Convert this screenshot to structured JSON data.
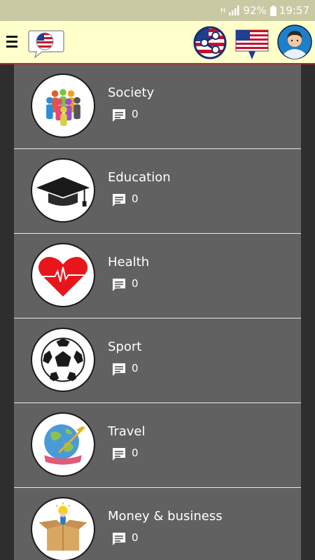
{
  "status_bar": {
    "network_label": "H",
    "battery_percent": "92%",
    "time": "19:57"
  },
  "app_bar": {
    "menu_icon": "hamburger-menu-icon",
    "language_icon": "us-flag-speech-bubble-icon",
    "share_icon": "share-icon",
    "flag_icon": "us-flag-pin-icon",
    "avatar_icon": "user-avatar-icon",
    "accent_color": "#d62020",
    "background_color": "#ffffcc"
  },
  "topics": [
    {
      "title": "Society",
      "comment_count": "0",
      "icon": "people-group-icon"
    },
    {
      "title": "Education",
      "comment_count": "0",
      "icon": "graduation-cap-icon"
    },
    {
      "title": "Health",
      "comment_count": "0",
      "icon": "heart-pulse-icon"
    },
    {
      "title": "Sport",
      "comment_count": "0",
      "icon": "soccer-ball-icon"
    },
    {
      "title": "Travel",
      "comment_count": "0",
      "icon": "globe-airplane-icon"
    },
    {
      "title": "Money & business",
      "comment_count": "0",
      "icon": "money-box-icon"
    }
  ]
}
